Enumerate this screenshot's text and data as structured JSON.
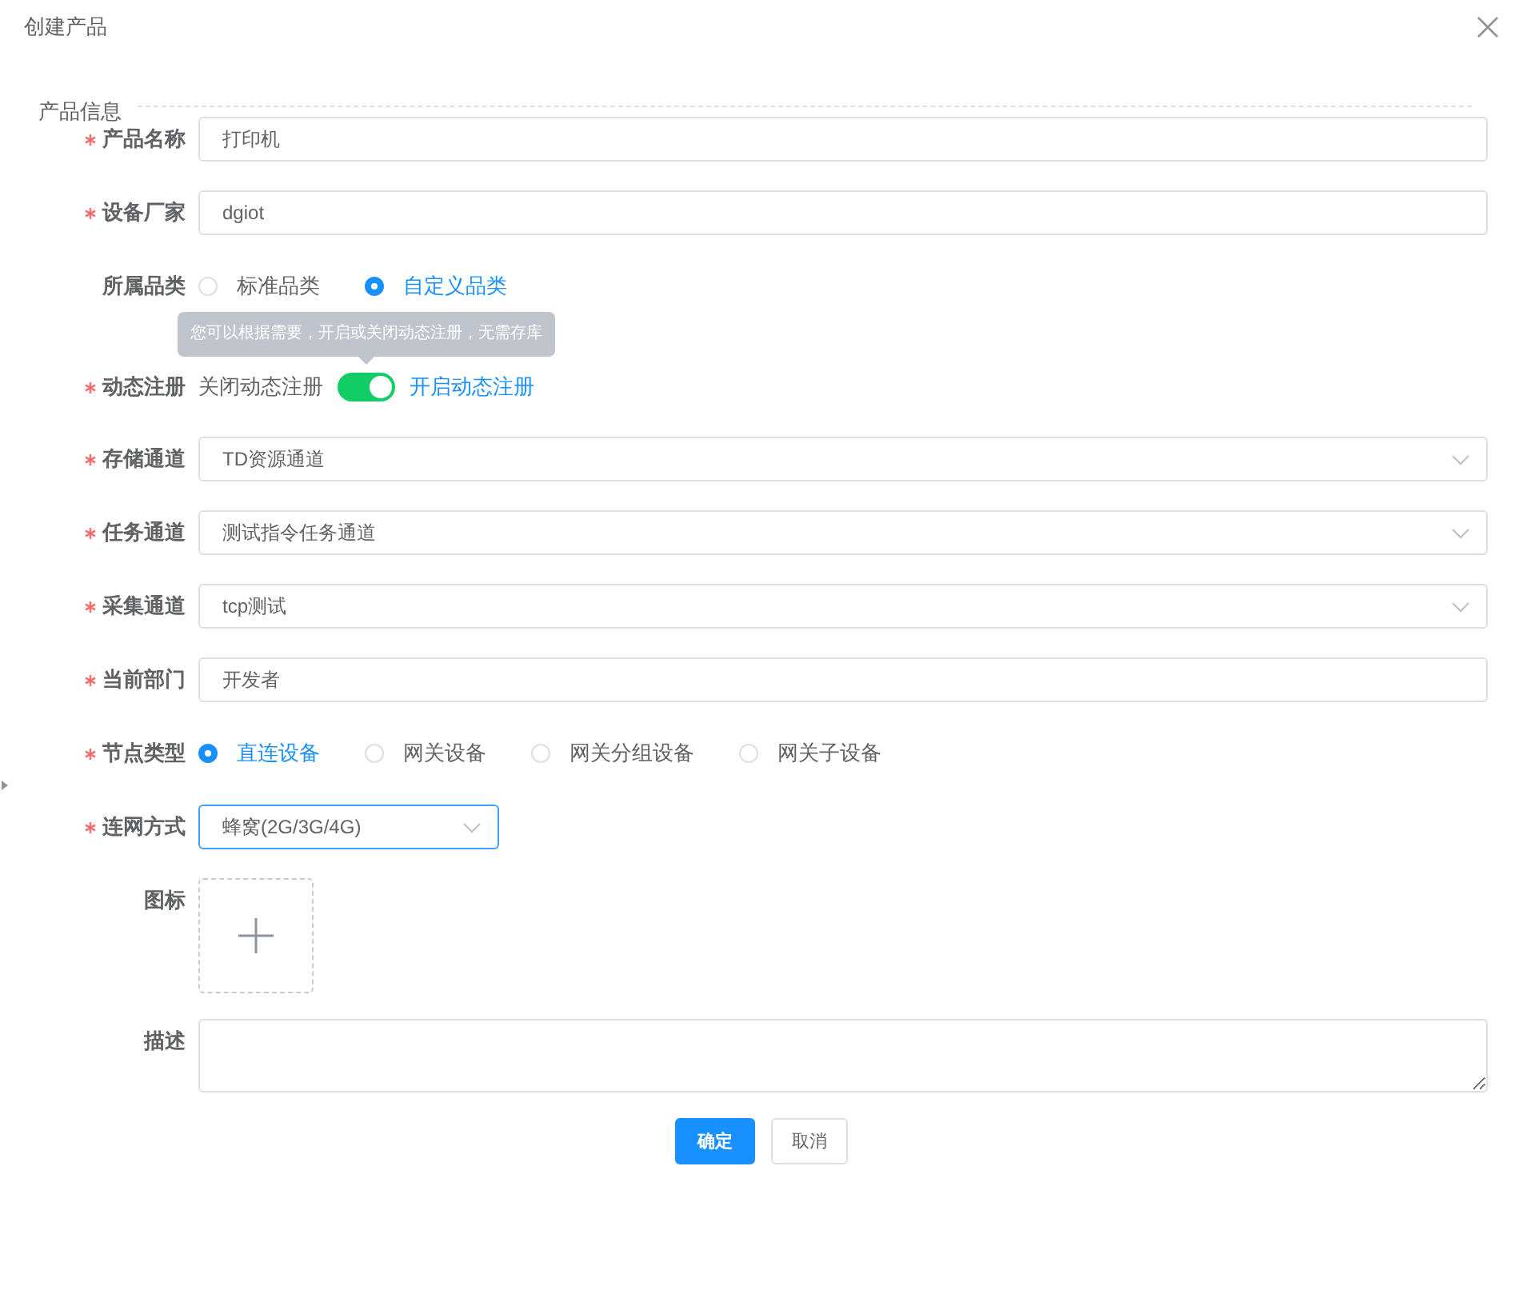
{
  "dialog": {
    "title": "创建产品"
  },
  "section": {
    "title": "产品信息"
  },
  "fields": [
    {
      "kind": "text",
      "label": "产品名称",
      "required": true,
      "value": "打印机"
    },
    {
      "kind": "text",
      "label": "设备厂家",
      "required": true,
      "value": "dgiot"
    },
    {
      "kind": "radio",
      "label": "所属品类",
      "required": false,
      "options": [
        {
          "label": "标准品类",
          "selected": false
        },
        {
          "label": "自定义品类",
          "selected": true
        }
      ]
    },
    {
      "kind": "switch",
      "label": "动态注册",
      "required": true,
      "off_label": "关闭动态注册",
      "on_label": "开启动态注册",
      "on": true,
      "tooltip": "您可以根据需要，开启或关闭动态注册，无需存库"
    },
    {
      "kind": "select",
      "label": "存储通道",
      "required": true,
      "value": "TD资源通道"
    },
    {
      "kind": "select",
      "label": "任务通道",
      "required": true,
      "value": "测试指令任务通道"
    },
    {
      "kind": "select",
      "label": "采集通道",
      "required": true,
      "value": "tcp测试"
    },
    {
      "kind": "text",
      "label": "当前部门",
      "required": true,
      "value": "开发者"
    },
    {
      "kind": "radio",
      "label": "节点类型",
      "required": true,
      "options": [
        {
          "label": "直连设备",
          "selected": true
        },
        {
          "label": "网关设备",
          "selected": false
        },
        {
          "label": "网关分组设备",
          "selected": false
        },
        {
          "label": "网关子设备",
          "selected": false
        }
      ]
    },
    {
      "kind": "select_small",
      "label": "连网方式",
      "required": true,
      "value": "蜂窝(2G/3G/4G)",
      "focused": true
    },
    {
      "kind": "upload",
      "label": "图标",
      "required": false
    },
    {
      "kind": "textarea",
      "label": "描述",
      "required": false
    }
  ],
  "buttons": [
    {
      "kind": "primary",
      "label": "确定"
    },
    {
      "kind": "default",
      "label": "取消"
    }
  ]
}
